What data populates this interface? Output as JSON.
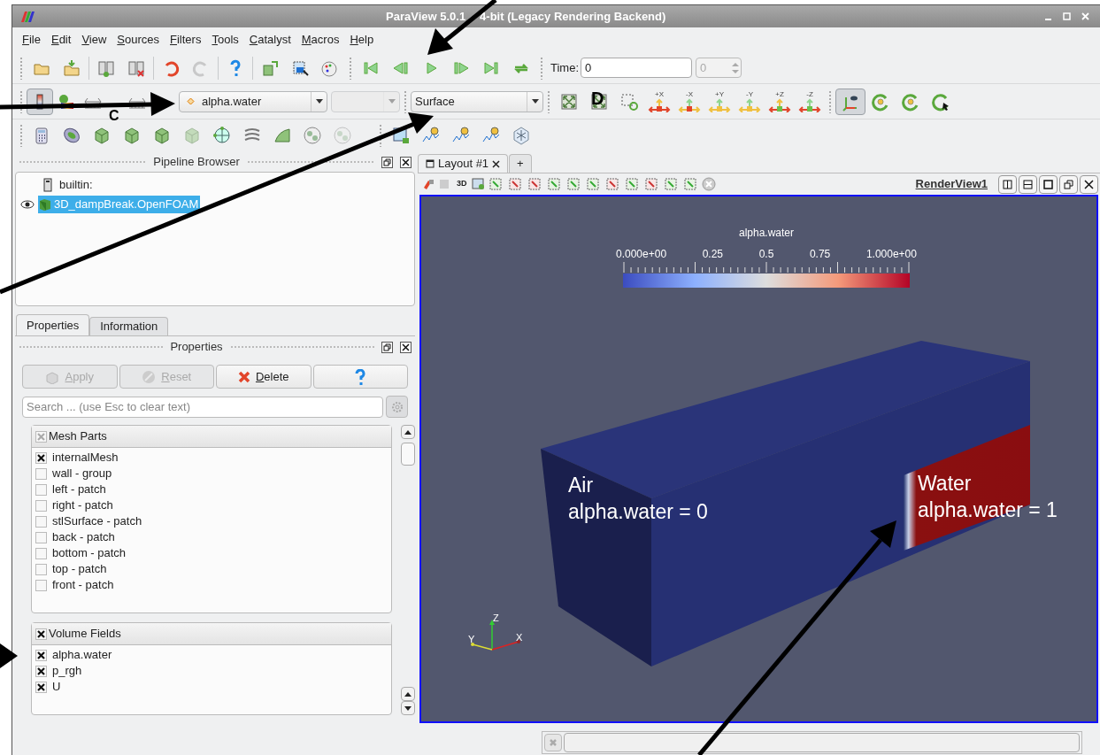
{
  "window": {
    "title_parts": [
      "ParaView 5.0.1",
      "4-bit (Legacy Rendering Backend)"
    ]
  },
  "menu": [
    "File",
    "Edit",
    "View",
    "Sources",
    "Filters",
    "Tools",
    "Catalyst",
    "Macros",
    "Help"
  ],
  "time": {
    "label": "Time:",
    "value": "0",
    "step": "0"
  },
  "color_toolbar": {
    "array": "alpha.water",
    "representation": "Surface"
  },
  "camera_buttons": [
    "+X",
    "-X",
    "+Y",
    "-Y",
    "+Z",
    "-Z"
  ],
  "pipeline_browser": {
    "title": "Pipeline Browser",
    "items": [
      {
        "label": "builtin:",
        "kind": "server",
        "selected": false
      },
      {
        "label": "3D_dampBreak.OpenFOAM",
        "kind": "source",
        "selected": true,
        "visible": true
      }
    ]
  },
  "panel_tabs": [
    {
      "label": "Properties",
      "selected": true
    },
    {
      "label": "Information",
      "selected": false
    }
  ],
  "properties": {
    "title": "Properties",
    "buttons": [
      {
        "kind": "apply",
        "label": "Apply",
        "disabled": true
      },
      {
        "kind": "reset",
        "label": "Reset",
        "disabled": true
      },
      {
        "kind": "delete",
        "label": "Delete",
        "disabled": false
      },
      {
        "kind": "help",
        "disabled": false
      }
    ],
    "search": {
      "placeholder": "Search ... (use Esc to clear text)"
    },
    "sections": [
      {
        "title": "Mesh Parts",
        "checked": true,
        "partial": true,
        "items": [
          {
            "label": "internalMesh",
            "checked": true
          },
          {
            "label": "wall - group",
            "checked": false
          },
          {
            "label": "left - patch",
            "checked": false
          },
          {
            "label": "right - patch",
            "checked": false
          },
          {
            "label": "stlSurface - patch",
            "checked": false
          },
          {
            "label": "back - patch",
            "checked": false
          },
          {
            "label": "bottom - patch",
            "checked": false
          },
          {
            "label": "top - patch",
            "checked": false
          },
          {
            "label": "front - patch",
            "checked": false
          }
        ]
      },
      {
        "title": "Volume Fields",
        "checked": true,
        "partial": false,
        "items": [
          {
            "label": "alpha.water",
            "checked": true
          },
          {
            "label": "p_rgh",
            "checked": true
          },
          {
            "label": "U",
            "checked": true
          }
        ]
      }
    ]
  },
  "layout_tabs": [
    {
      "label": "Layout #1",
      "selected": true
    },
    {
      "label": "+",
      "selected": false
    }
  ],
  "view_toolbar": {
    "mode": "3D",
    "view_name": "RenderView1"
  },
  "render_view": {
    "color_legend": {
      "title": "alpha.water",
      "labels": [
        "0.000e+00",
        "0.25",
        "0.5",
        "0.75",
        "1.000e+00"
      ]
    },
    "labels": [
      {
        "lines": [
          "Air",
          "alpha.water = 0"
        ]
      },
      {
        "lines": [
          "Water",
          "alpha.water = 1"
        ]
      }
    ],
    "axes": [
      "Z",
      "Y",
      "X"
    ]
  },
  "annotations": {
    "letters": [
      "C",
      "D"
    ]
  }
}
